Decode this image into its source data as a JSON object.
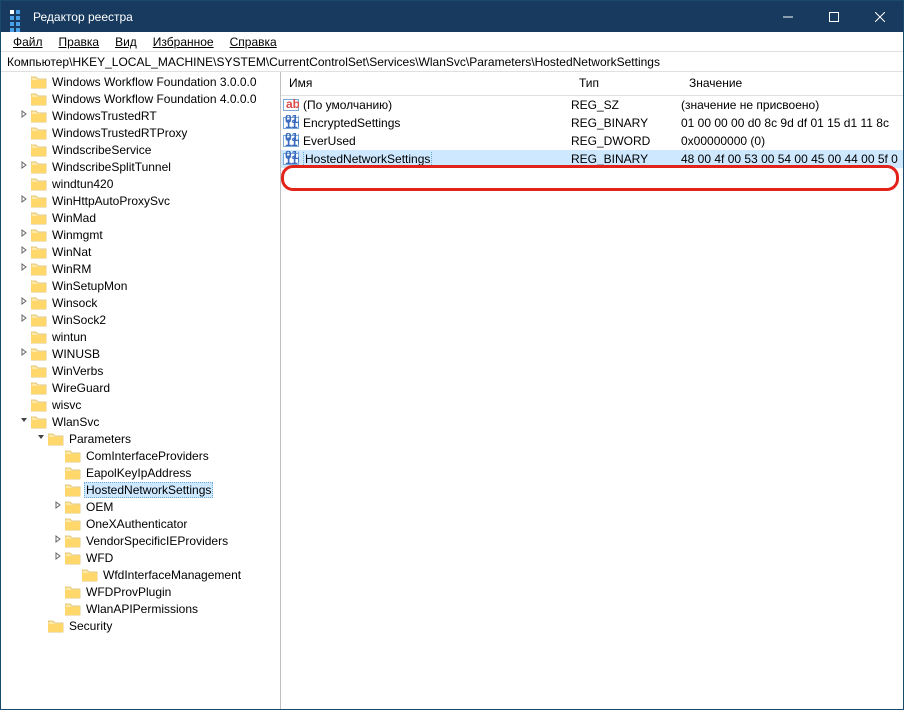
{
  "title": "Редактор реестра",
  "menu": {
    "file": "Файл",
    "edit": "Правка",
    "view": "Вид",
    "favorites": "Избранное",
    "help": "Справка"
  },
  "address": "Компьютер\\HKEY_LOCAL_MACHINE\\SYSTEM\\CurrentControlSet\\Services\\WlanSvc\\Parameters\\HostedNetworkSettings",
  "columns": {
    "name": "Имя",
    "type": "Тип",
    "data": "Значение"
  },
  "tree": [
    {
      "indent": 1,
      "label": "Windows Workflow Foundation 3.0.0.0"
    },
    {
      "indent": 1,
      "label": "Windows Workflow Foundation 4.0.0.0"
    },
    {
      "indent": 1,
      "label": "WindowsTrustedRT",
      "exp": ">"
    },
    {
      "indent": 1,
      "label": "WindowsTrustedRTProxy"
    },
    {
      "indent": 1,
      "label": "WindscribeService"
    },
    {
      "indent": 1,
      "label": "WindscribeSplitTunnel",
      "exp": ">"
    },
    {
      "indent": 1,
      "label": "windtun420"
    },
    {
      "indent": 1,
      "label": "WinHttpAutoProxySvc",
      "exp": ">"
    },
    {
      "indent": 1,
      "label": "WinMad"
    },
    {
      "indent": 1,
      "label": "Winmgmt",
      "exp": ">"
    },
    {
      "indent": 1,
      "label": "WinNat",
      "exp": ">"
    },
    {
      "indent": 1,
      "label": "WinRM",
      "exp": ">"
    },
    {
      "indent": 1,
      "label": "WinSetupMon"
    },
    {
      "indent": 1,
      "label": "Winsock",
      "exp": ">"
    },
    {
      "indent": 1,
      "label": "WinSock2",
      "exp": ">"
    },
    {
      "indent": 1,
      "label": "wintun"
    },
    {
      "indent": 1,
      "label": "WINUSB",
      "exp": ">"
    },
    {
      "indent": 1,
      "label": "WinVerbs"
    },
    {
      "indent": 1,
      "label": "WireGuard"
    },
    {
      "indent": 1,
      "label": "wisvc"
    },
    {
      "indent": 1,
      "label": "WlanSvc",
      "exp": "v"
    },
    {
      "indent": 2,
      "label": "Parameters",
      "exp": "v"
    },
    {
      "indent": 3,
      "label": "ComInterfaceProviders"
    },
    {
      "indent": 3,
      "label": "EapolKeyIpAddress"
    },
    {
      "indent": 3,
      "label": "HostedNetworkSettings",
      "selected": true
    },
    {
      "indent": 3,
      "label": "OEM",
      "exp": ">"
    },
    {
      "indent": 3,
      "label": "OneXAuthenticator"
    },
    {
      "indent": 3,
      "label": "VendorSpecificIEProviders",
      "exp": ">"
    },
    {
      "indent": 3,
      "label": "WFD",
      "exp": ">"
    },
    {
      "indent": 4,
      "label": "WfdInterfaceManagement"
    },
    {
      "indent": 3,
      "label": "WFDProvPlugin"
    },
    {
      "indent": 3,
      "label": "WlanAPIPermissions"
    },
    {
      "indent": 2,
      "label": "Security"
    }
  ],
  "values": [
    {
      "icon": "str",
      "name": "(По умолчанию)",
      "type": "REG_SZ",
      "data": "(значение не присвоено)"
    },
    {
      "icon": "bin",
      "name": "EncryptedSettings",
      "type": "REG_BINARY",
      "data": "01 00 00 00 d0 8c 9d df 01 15 d1 11 8c"
    },
    {
      "icon": "bin",
      "name": "EverUsed",
      "type": "REG_DWORD",
      "data": "0x00000000 (0)"
    },
    {
      "icon": "bin",
      "name": "HostedNetworkSettings",
      "type": "REG_BINARY",
      "data": "48 00 4f 00 53 00 54 00 45 00 44 00 5f 0",
      "selected": true
    }
  ]
}
